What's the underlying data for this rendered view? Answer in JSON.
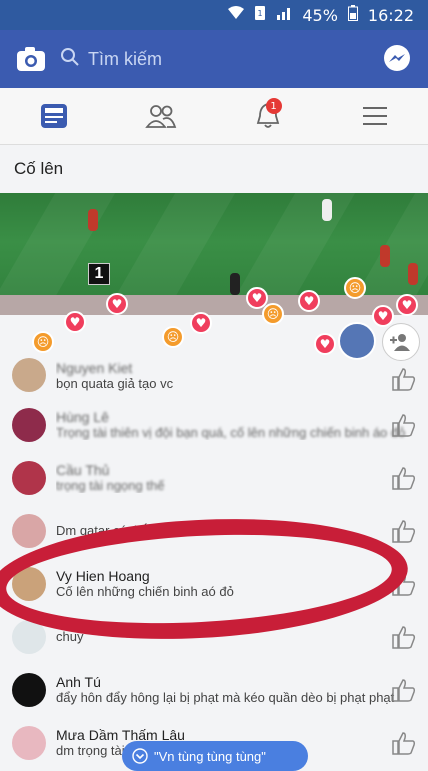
{
  "status": {
    "battery": "45%",
    "time": "16:22"
  },
  "header": {
    "search_placeholder": "Tìm kiếm"
  },
  "tabs": {
    "notification_count": "1"
  },
  "post": {
    "title": "Cố lên",
    "score_digit": "1"
  },
  "comments": [
    {
      "name": "Nguyen Kiet",
      "message": "bọn quata giả tạo vc"
    },
    {
      "name": "Hùng Lê",
      "message": "Trọng tài thiên vị đội bạn quá, cố lên những chiến binh áo đỏ"
    },
    {
      "name": "Cầu Thủ",
      "message": "trọng tài ngọng thế"
    },
    {
      "name": "",
      "message": "Dm qatar có thắng..."
    },
    {
      "name": "Vy Hien Hoang",
      "message": "Cố lên những chiến binh aó đỏ"
    },
    {
      "name": "",
      "message": "chuy"
    },
    {
      "name": "Anh Tú",
      "message": "đẩy hôn đẩy hông lại bị phạt mà kéo quần dèo bị phạt phạt"
    },
    {
      "name": "Mưa Dầm Thấm Lâu",
      "message": "dm trọng tài thiên vị"
    }
  ],
  "footer": {
    "new_comment_pill": "\"Vn tùng tùng tùng\""
  },
  "colors": {
    "statusbar": "#2f5aa0",
    "appbar": "#3b5bb0",
    "annotation_circle": "#c81e38",
    "pill": "#4a7fe0"
  }
}
